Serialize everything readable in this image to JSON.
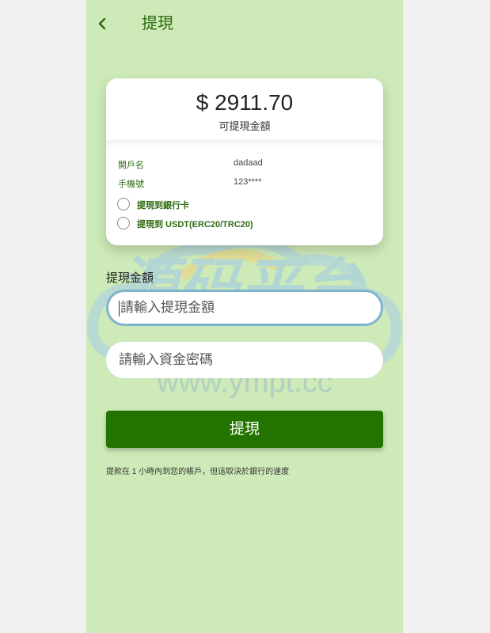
{
  "header": {
    "title": "提現"
  },
  "card": {
    "balance": "$ 2911.70",
    "balance_label": "可提現金額",
    "account_name_key": "開戶名",
    "account_name_value": "dadaad",
    "phone_key": "手機號",
    "phone_value": "123****",
    "options": [
      {
        "label": "提現到銀行卡",
        "selected": false
      },
      {
        "label": "提現到 USDT(ERC20/TRC20)",
        "selected": false
      }
    ]
  },
  "form": {
    "amount_label": "提現金額",
    "amount_placeholder": "請輸入提現金額",
    "password_placeholder": "請輸入資金密碼",
    "submit_label": "提現",
    "note": "提款在 1 小時內到您的帳戶，但這取決於銀行的速度"
  },
  "watermark": {
    "text": "源码平台",
    "url": "www.ympt.cc"
  },
  "colors": {
    "background": "#cdeab8",
    "accent_green": "#227300",
    "label_green": "#2f6b12",
    "card": "#ffffff"
  }
}
